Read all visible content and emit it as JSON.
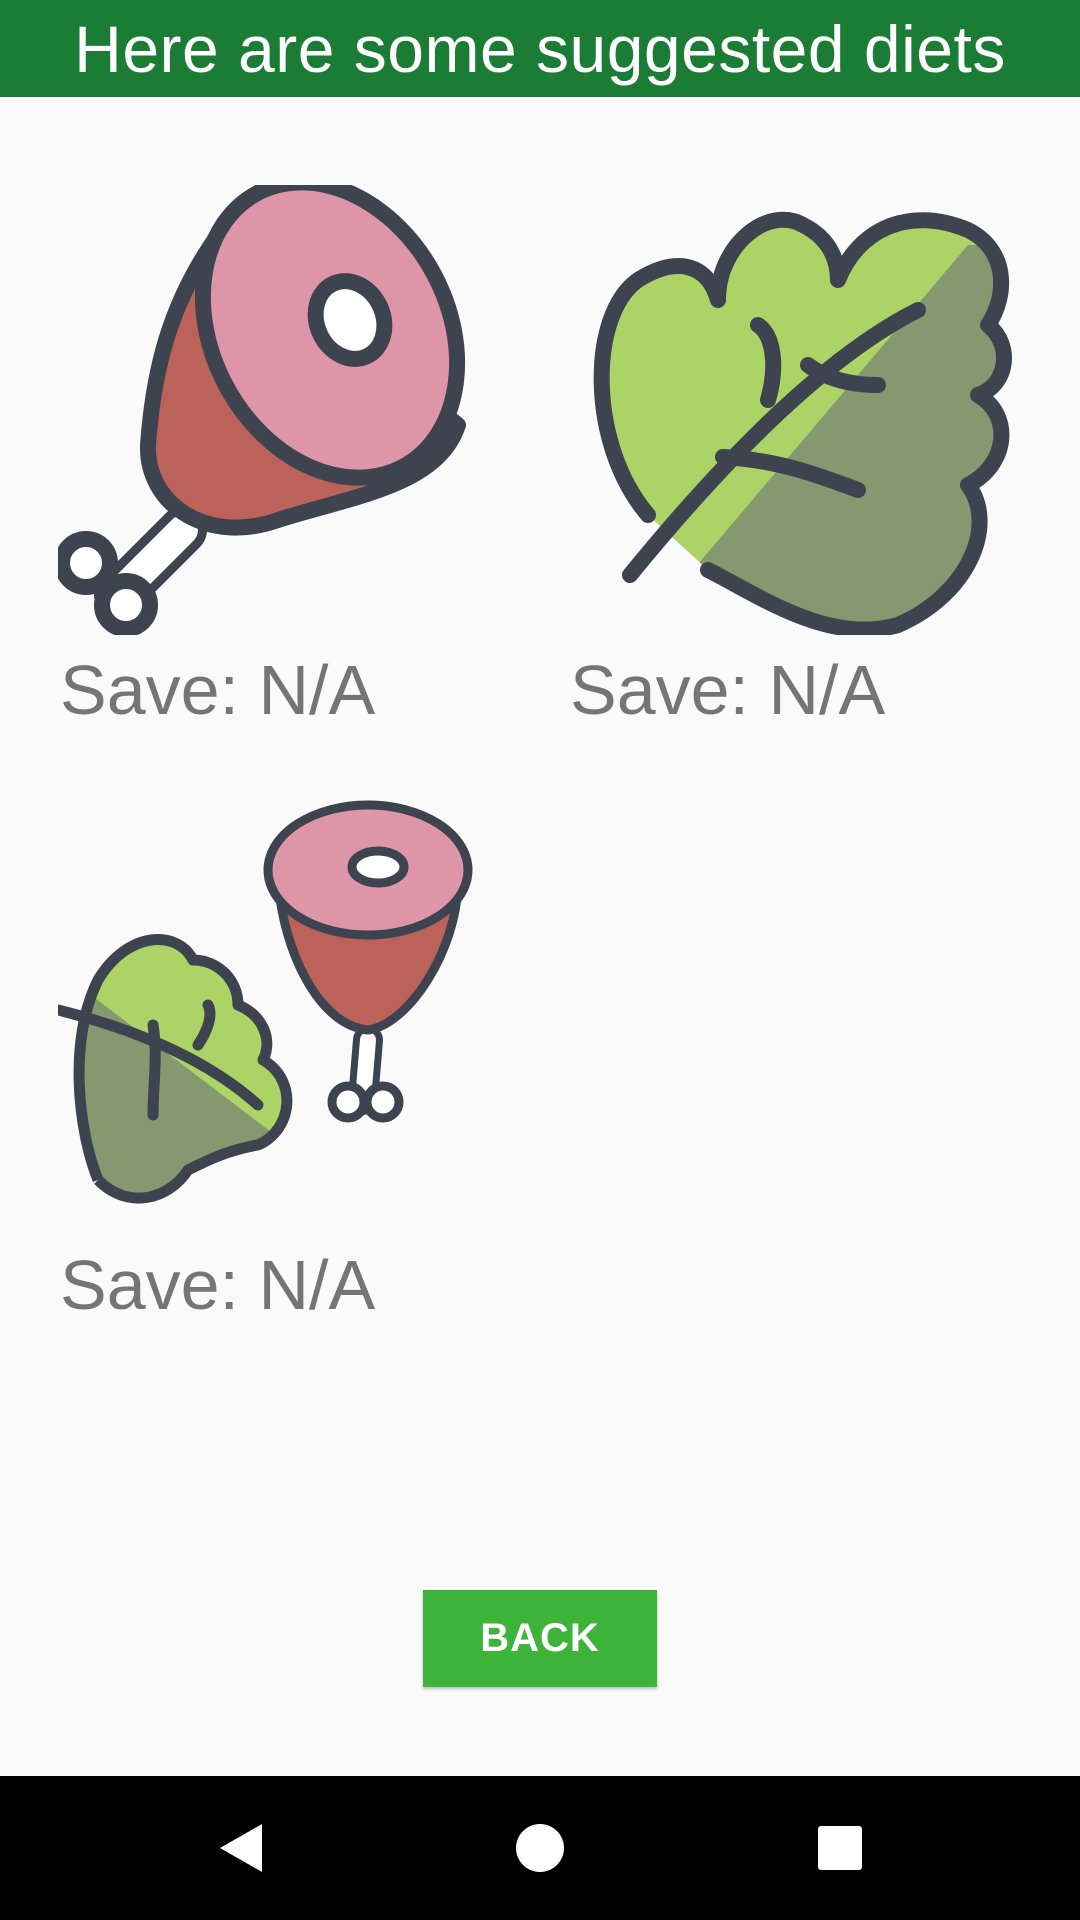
{
  "header": {
    "title": "Here are some suggested diets"
  },
  "diets": [
    {
      "icon": "ham-leg-icon",
      "save_label": "Save: N/A"
    },
    {
      "icon": "leaf-icon",
      "save_label": "Save: N/A"
    },
    {
      "icon": "leaf-and-ham-icon",
      "save_label": "Save: N/A"
    }
  ],
  "actions": {
    "back_label": "BACK"
  },
  "navbar": {
    "items": [
      {
        "icon": "back-triangle-icon"
      },
      {
        "icon": "home-circle-icon"
      },
      {
        "icon": "recents-square-icon"
      }
    ]
  },
  "colors": {
    "header_bg": "#1b7d35",
    "button_bg": "#3db33a",
    "label_text": "#757575",
    "navbar_bg": "#000000"
  }
}
